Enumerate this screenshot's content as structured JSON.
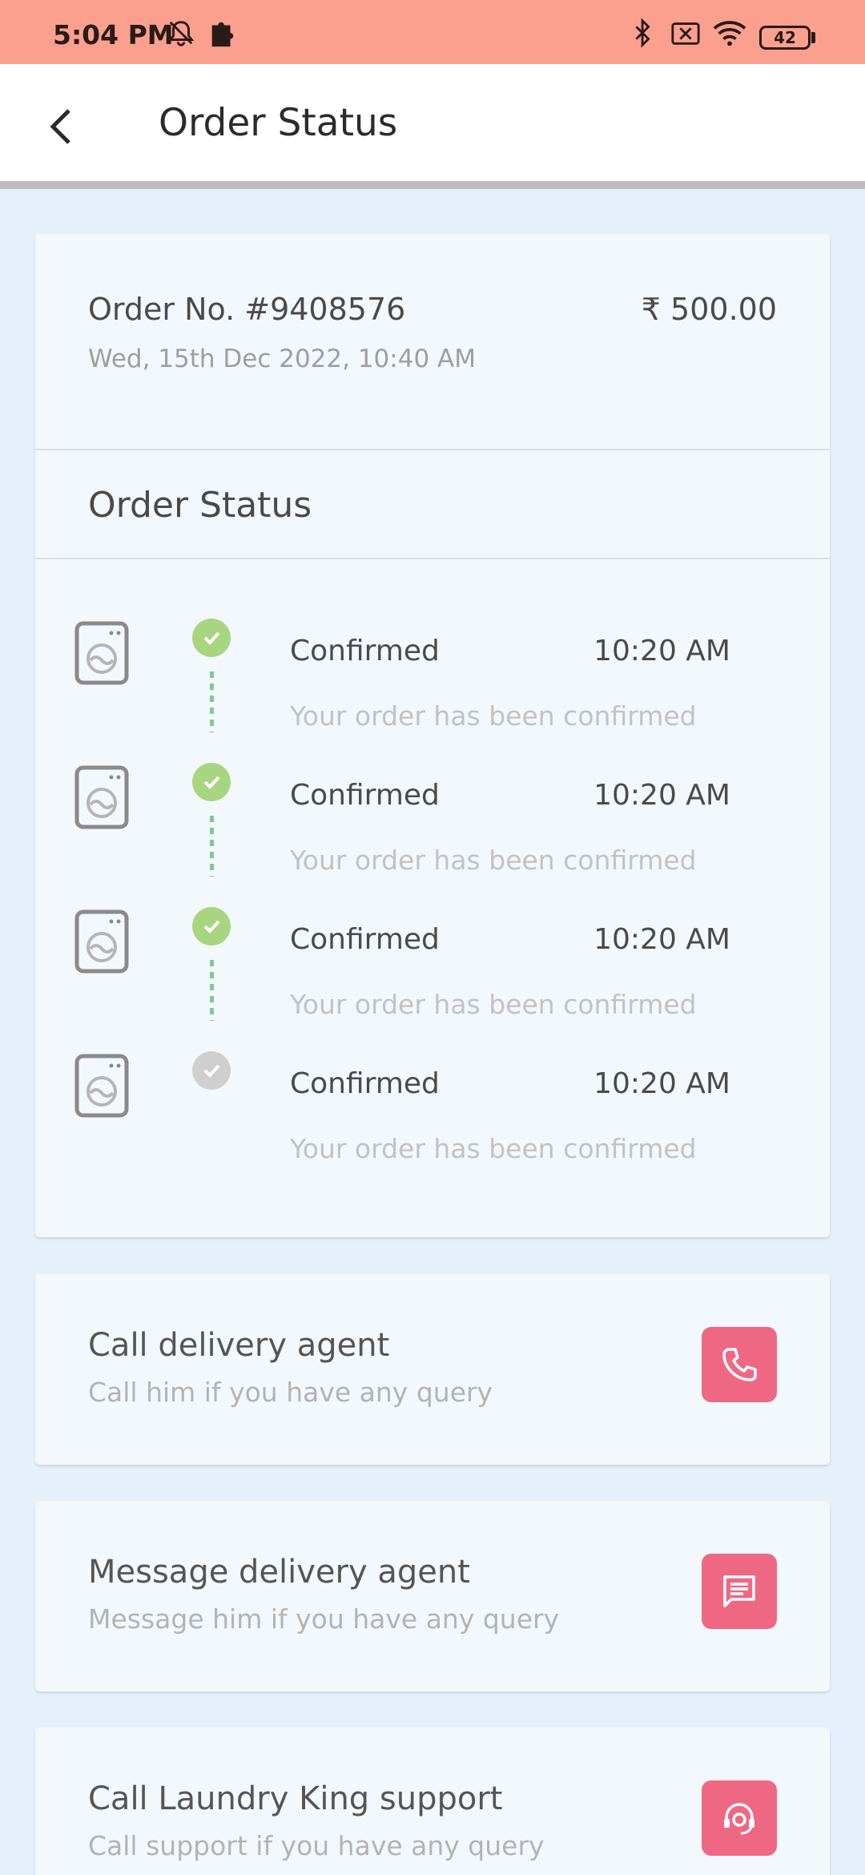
{
  "status_bar": {
    "time": "5:04 PM",
    "battery": "42",
    "color": "#fba08f"
  },
  "header": {
    "title": "Order Status"
  },
  "order": {
    "number": "Order No. #9408576",
    "price": "₹ 500.00",
    "date": "Wed, 15th Dec 2022, 10:40 AM"
  },
  "status_section": {
    "heading": "Order Status",
    "steps": [
      {
        "label": "Confirmed",
        "time": "10:20 AM",
        "description": "Your order has been confirmed",
        "state": "done"
      },
      {
        "label": "Confirmed",
        "time": "10:20 AM",
        "description": "Your order has been confirmed",
        "state": "done"
      },
      {
        "label": "Confirmed",
        "time": "10:20 AM",
        "description": "Your order has been confirmed",
        "state": "done"
      },
      {
        "label": "Confirmed",
        "time": "10:20 AM",
        "description": "Your order has been confirmed",
        "state": "pending"
      }
    ]
  },
  "actions": [
    {
      "title": "Call delivery agent",
      "subtitle": "Call him if you have any query",
      "icon": "phone-icon"
    },
    {
      "title": "Message delivery agent",
      "subtitle": "Message him if you have any query",
      "icon": "message-icon"
    },
    {
      "title": "Call Laundry King support",
      "subtitle": "Call support if you have any query",
      "icon": "support-agent-icon"
    }
  ],
  "colors": {
    "accent": "#ef6883",
    "done": "#a8d57f",
    "pending": "#cfcfcf",
    "connector": "#7ccb93",
    "background": "#e6f0fa"
  }
}
